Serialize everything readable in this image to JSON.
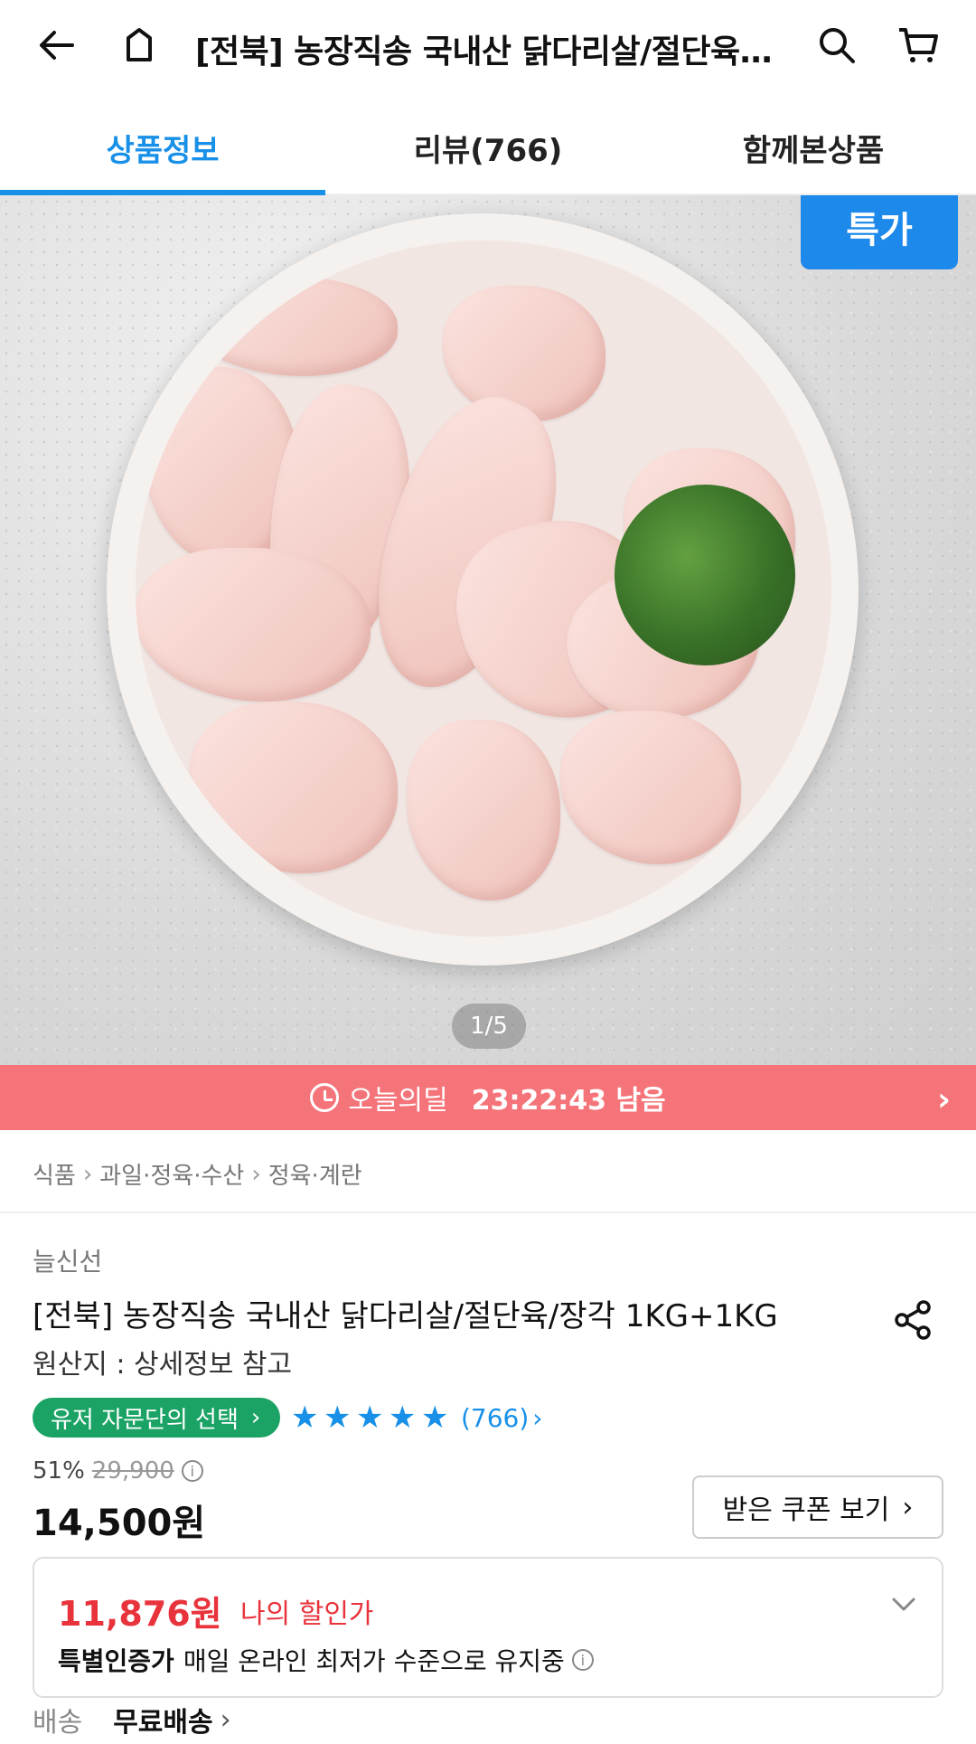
{
  "appbar": {
    "title": "[전북] 농장직송 국내산 닭다리살/절단육/…",
    "icons": [
      "back-arrow-icon",
      "home-icon",
      "search-icon",
      "cart-icon"
    ]
  },
  "tabs": [
    {
      "label": "상품정보",
      "active": true
    },
    {
      "label": "리뷰(766)",
      "active": false
    },
    {
      "label": "함께본상품",
      "active": false
    }
  ],
  "hero": {
    "badge": "특가",
    "pager": "1/5"
  },
  "deal": {
    "label": "오늘의딜",
    "time": "23:22:43 남음"
  },
  "breadcrumb": [
    "식품",
    "과일·정육·수산",
    "정육·계란"
  ],
  "product": {
    "brand": "늘신선",
    "title": "[전북] 농장직송 국내산 닭다리살/절단육/장각 1KG+1KG",
    "origin": "원산지 : 상세정보 참고",
    "pick_badge": "유저 자문단의 선택",
    "rating_stars": 5,
    "review_count": "(766)",
    "discount_rate": "51%",
    "original_price": "29,900",
    "price": "14,500원",
    "coupon_button": "받은 쿠폰 보기"
  },
  "my_deal": {
    "price": "11,876원",
    "label": "나의 할인가",
    "cert_label": "특별인증가",
    "cert_text": "매일 온라인 최저가 수준으로 유지중"
  },
  "shipping": {
    "label": "배송",
    "value": "무료배송"
  },
  "colors": {
    "accent": "#1890e8",
    "deal_bar": "#f4747a",
    "pick_badge": "#1aa364",
    "my_price": "#e8333c"
  }
}
